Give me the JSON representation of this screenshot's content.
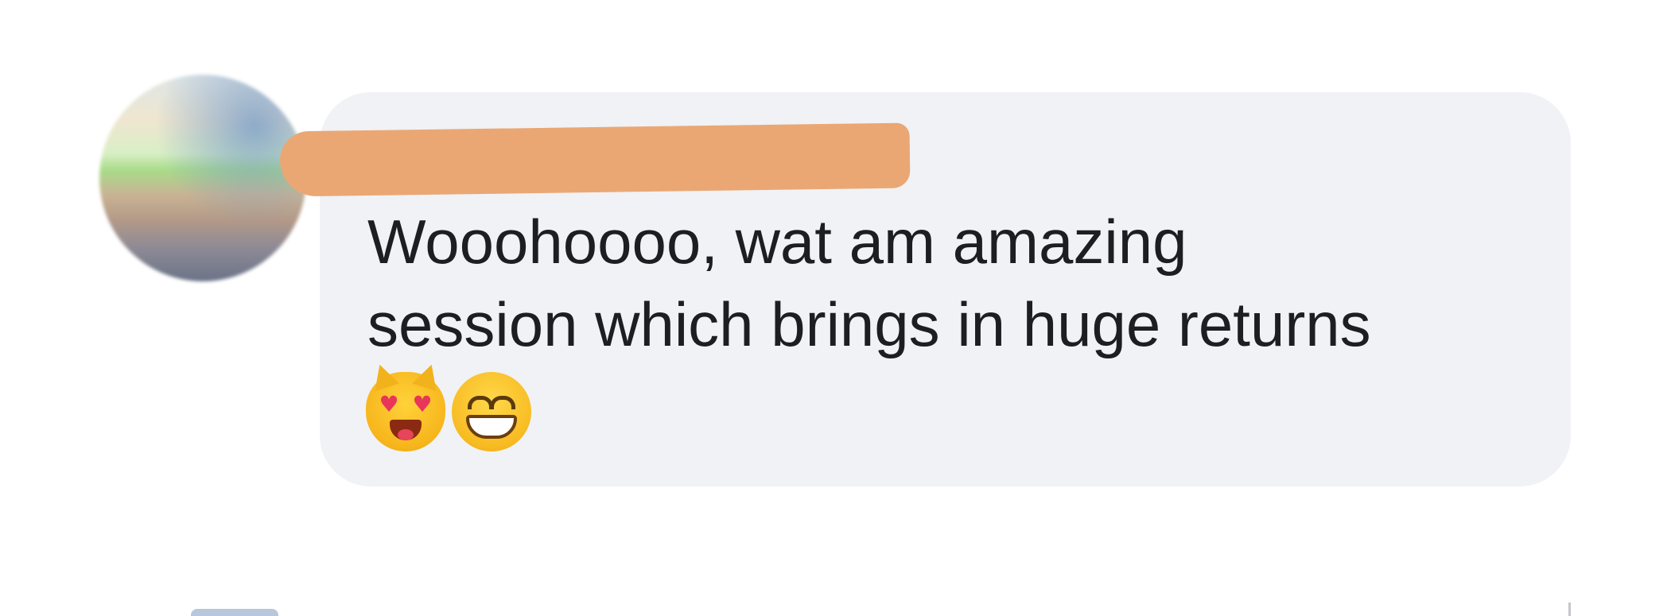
{
  "comment": {
    "author_name": "",
    "text_line_1": "Wooohoooo, wat am amazing",
    "text_line_2": "session which brings in huge returns",
    "emojis": [
      "smiling-cat-heart-eyes",
      "grinning-face-smiling-eyes"
    ]
  },
  "colors": {
    "bubble_background": "#f0f2f5",
    "text": "#1c1e21",
    "redaction": "#eaa774"
  }
}
